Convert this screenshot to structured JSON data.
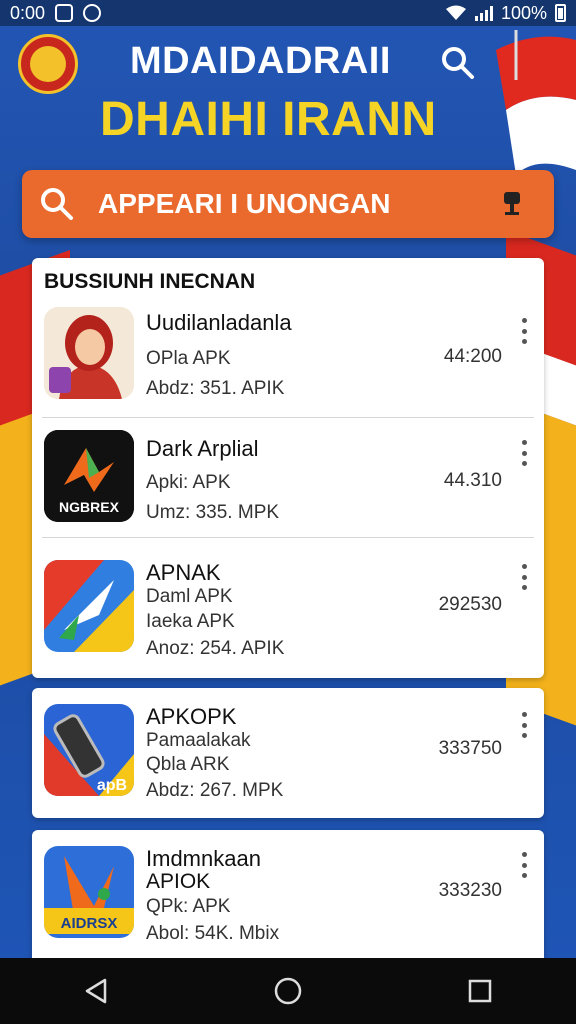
{
  "status_bar": {
    "time": "0:00",
    "battery": "100%"
  },
  "header": {
    "title_line1": "MDAIDADRAII",
    "title_line2": "DHAIHI IRANN"
  },
  "search": {
    "query": "APPEARI I UNONGAN"
  },
  "section": {
    "title": "BUSSIUNH INECNAN"
  },
  "apps": [
    {
      "name": "Uudilanladanla",
      "line1": "OPla APK",
      "line2": "Abdz: 351. APIK",
      "size": "44:200"
    },
    {
      "name": "Dark Arplial",
      "line1": "Apki: APK",
      "line2": "Umz: 335. MPK",
      "size": "44.310",
      "icon_text": "NGBREX"
    },
    {
      "name": "APNAK",
      "line1": "Daml APK",
      "line2": "Iaeka APK",
      "line3": "Anoz: 254. APIK",
      "size": "292530"
    },
    {
      "name": "APKOPK",
      "line1": "Pamaalakak",
      "line2": "Qbla ARK",
      "line3": "Abdz: 267. MPK",
      "size": "333750",
      "icon_text": "apB"
    },
    {
      "name": "Imdmnkaan",
      "name2": "APIOK",
      "line1": "QPk: APK",
      "line2": "Abol: 54K. Mbix",
      "size": "333230",
      "icon_text": "AIDRSX"
    }
  ],
  "colors": {
    "accent": "#ea6a2e",
    "title_yellow": "#f6d425",
    "bg_blue": "#1f4fa8"
  }
}
